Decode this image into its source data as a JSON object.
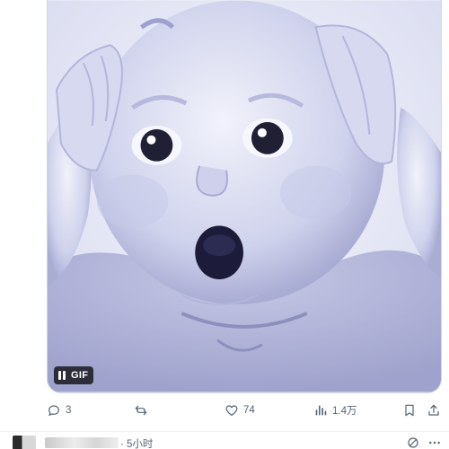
{
  "media": {
    "badge_label": "GIF",
    "image_icon": "surprised-baby-gif"
  },
  "actions": {
    "reply_count": "3",
    "retweet_count": "",
    "like_count": "74",
    "views_count": "1.4万"
  },
  "next_tweet": {
    "timestamp": "· 5小时"
  },
  "colors": {
    "icon_gray": "#536471",
    "border": "#cfd9de",
    "badge_bg": "#000000"
  }
}
